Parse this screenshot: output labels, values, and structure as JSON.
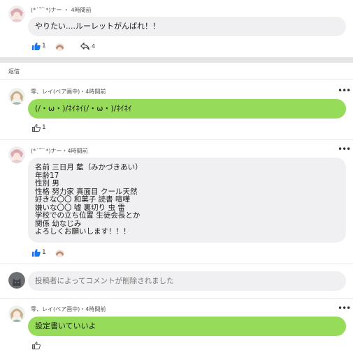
{
  "post": {
    "author": "(*´꒳`*)ナー ・ 4時間前",
    "body": "やりたい....ルーレットがんばれ！！",
    "like_count": "1",
    "share_count": "4"
  },
  "replies_label": "返信",
  "comments": [
    {
      "author": "零、レイ(ペア画中)・4時間前",
      "body": "(/・ω・)/ﾈｲﾈｲ(/・ω・)/ﾈｲﾈｲ",
      "like_count": "1"
    },
    {
      "author": "(*´꒳`*)ナー・4時間前",
      "body": "名前 三日月 藍（みかづきあい）\n年齢17\n性別 男\n性格 努力家 真面目 クール天然\n好きな〇〇 和菓子 読書 喧嘩\n嫌いな〇〇 嘘 裏切り 虫 雷\n学校での立ち位置 生徒会長とか\n関係 幼なじみ\nよろしくお願いします！！！",
      "like_count": "1"
    },
    {
      "body": "投稿者によってコメントが削除されました"
    },
    {
      "author": "零、レイ(ペア画中)・4時間前",
      "body": "設定書いていいよ"
    }
  ],
  "more_menu_glyph": "•••",
  "colors": {
    "green_bubble": "#96dc5a",
    "gray_bubble": "#f0f0f2",
    "like_active": "#1877f2",
    "like_inactive": "#555555"
  }
}
